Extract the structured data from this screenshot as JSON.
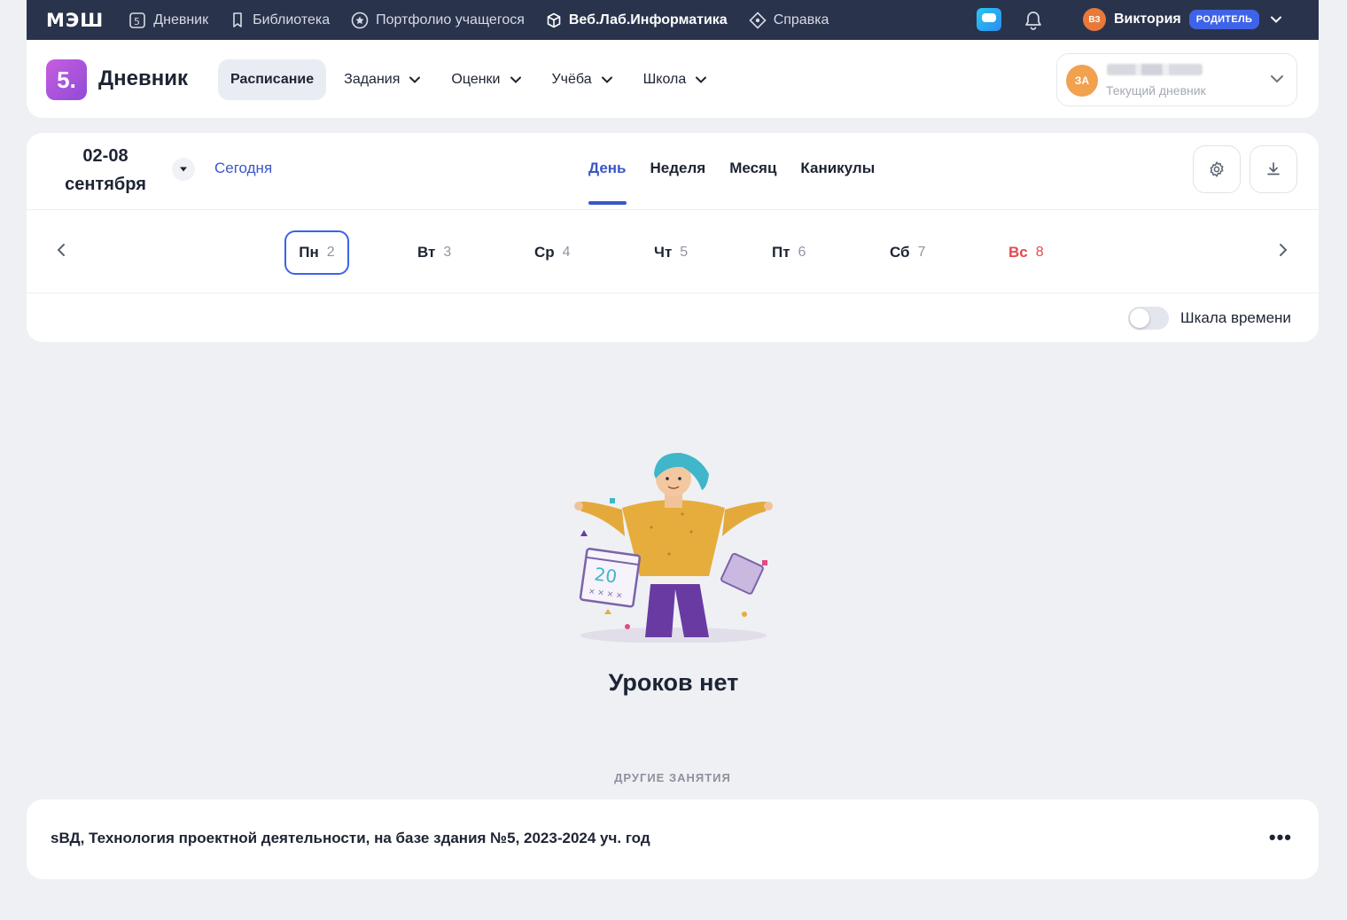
{
  "topbar": {
    "logo": "МЭШ",
    "nav": [
      {
        "label": "Дневник",
        "icon": "diary-5-icon"
      },
      {
        "label": "Библиотека",
        "icon": "bookmark-icon"
      },
      {
        "label": "Портфолио учащегося",
        "icon": "star-circle-icon"
      },
      {
        "label": "Веб.Лаб.Информатика",
        "icon": "cube-icon"
      },
      {
        "label": "Справка",
        "icon": "diamond-icon"
      }
    ],
    "user": {
      "initials": "ВЗ",
      "name": "Виктория",
      "role": "РОДИТЕЛЬ"
    }
  },
  "subheader": {
    "logo_text": "5.",
    "title": "Дневник",
    "menu": [
      {
        "label": "Расписание",
        "active": true,
        "dropdown": false
      },
      {
        "label": "Задания",
        "active": false,
        "dropdown": true
      },
      {
        "label": "Оценки",
        "active": false,
        "dropdown": true
      },
      {
        "label": "Учёба",
        "active": false,
        "dropdown": true
      },
      {
        "label": "Школа",
        "active": false,
        "dropdown": true
      }
    ],
    "diary": {
      "initials": "ЗА",
      "subtitle": "Текущий дневник"
    }
  },
  "schedule": {
    "date_line1": "02-08",
    "date_line2": "сентября",
    "today": "Сегодня",
    "views": [
      "День",
      "Неделя",
      "Месяц",
      "Каникулы"
    ],
    "active_view": "День",
    "days": [
      {
        "name": "Пн",
        "num": "2",
        "selected": true
      },
      {
        "name": "Вт",
        "num": "3"
      },
      {
        "name": "Ср",
        "num": "4"
      },
      {
        "name": "Чт",
        "num": "5"
      },
      {
        "name": "Пт",
        "num": "6"
      },
      {
        "name": "Сб",
        "num": "7"
      },
      {
        "name": "Вс",
        "num": "8",
        "weekend": true
      }
    ],
    "timeline_label": "Шкала времени",
    "timeline_on": false
  },
  "empty": {
    "title": "Уроков нет",
    "calendar_num": "20",
    "other_caption": "ДРУГИЕ ЗАНЯТИЯ"
  },
  "activities": [
    {
      "text": "sВД, Технология проектной деятельности, на базе здания №5, 2023-2024 уч. год"
    }
  ],
  "colors": {
    "topbar": "#2a334c",
    "accent": "#3a56c9",
    "weekend": "#e5484d",
    "role_badge": "#3f63e8"
  }
}
